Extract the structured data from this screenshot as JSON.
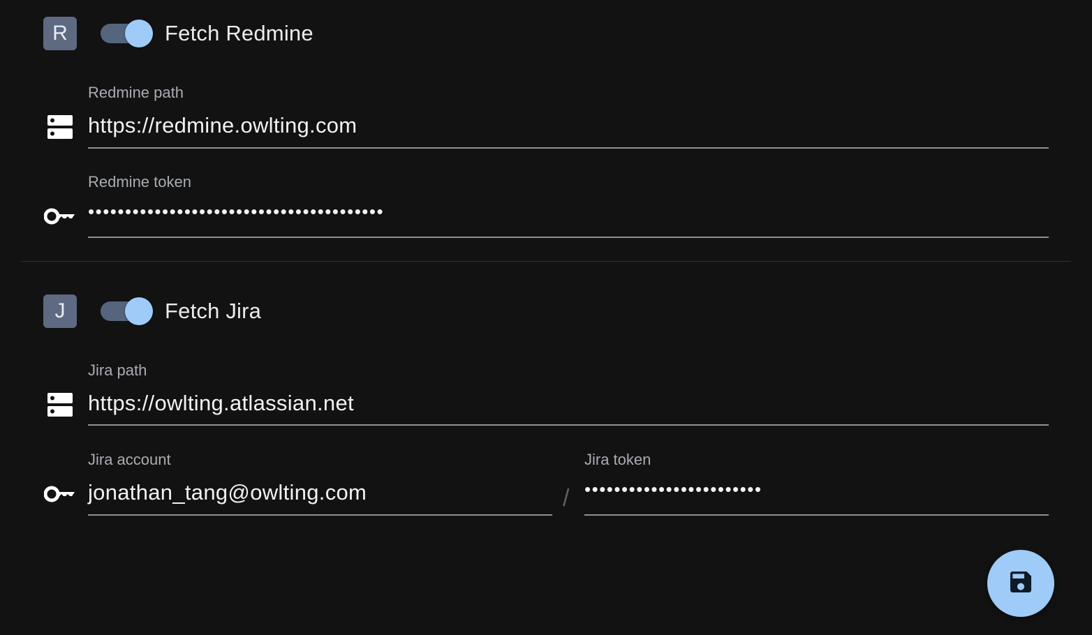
{
  "redmine": {
    "avatar_letter": "R",
    "toggle_on": true,
    "title": "Fetch Redmine",
    "path_label": "Redmine path",
    "path_value": "https://redmine.owlting.com",
    "token_label": "Redmine token",
    "token_value": "••••••••••••••••••••••••••••••••••••••••"
  },
  "jira": {
    "avatar_letter": "J",
    "toggle_on": true,
    "title": "Fetch Jira",
    "path_label": "Jira path",
    "path_value": "https://owlting.atlassian.net",
    "account_label": "Jira account",
    "account_value": "jonathan_tang@owlting.com",
    "separator": "/",
    "token_label": "Jira token",
    "token_value": "••••••••••••••••••••••••"
  },
  "icons": {
    "server": "server-icon",
    "key": "key-icon",
    "save": "save-icon"
  },
  "colors": {
    "background": "#121212",
    "accent": "#9ecbf7",
    "avatar": "#5d6a82",
    "toggle_track": "#54657d"
  }
}
